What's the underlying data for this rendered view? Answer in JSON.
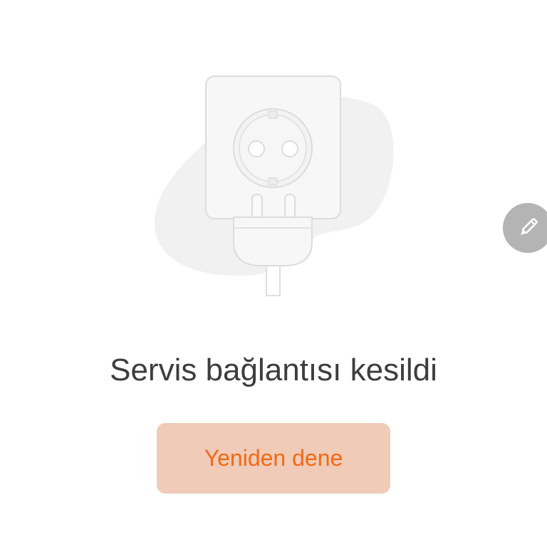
{
  "illustration": {
    "icon": "unplugged-socket-icon"
  },
  "error": {
    "message": "Servis bağlantısı kesildi"
  },
  "retry": {
    "label": "Yeniden dene"
  },
  "edit_button": {
    "icon": "pencil-icon"
  },
  "colors": {
    "message_text": "#3d3d3d",
    "button_background": "#f0cbb8",
    "button_text": "#f26a14",
    "fab_background": "#b4b4b4",
    "illustration_blob": "#f1f1f1",
    "illustration_stroke": "#dcdcdc"
  }
}
